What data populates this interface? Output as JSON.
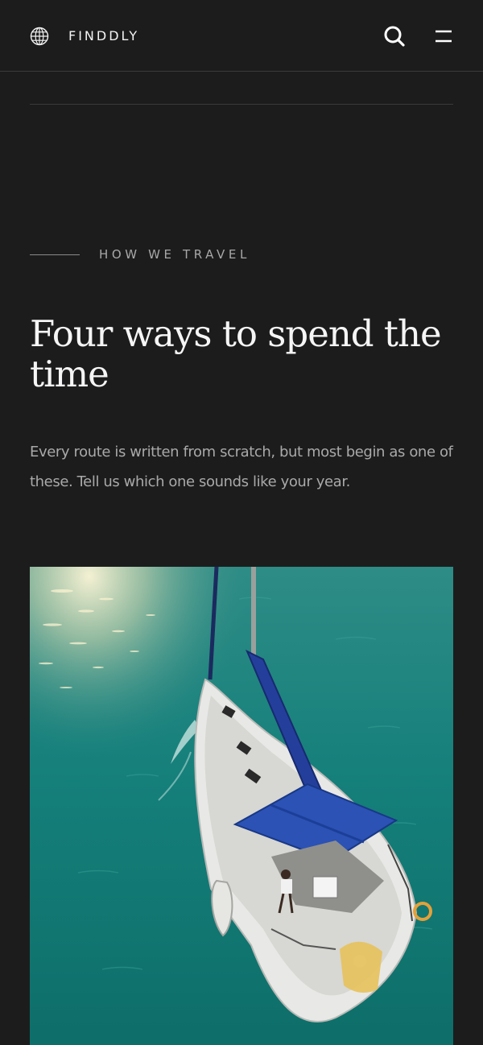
{
  "header": {
    "brand_icon": "globe-icon",
    "brand_name": "FINDDLY",
    "search_icon": "search-icon",
    "menu_icon": "menu-icon"
  },
  "section": {
    "eyebrow": "HOW WE TRAVEL",
    "heading": "Four ways to spend the time",
    "intro": "Every route is written from scratch, but most begin as one of these. Tell us which one sounds like your year."
  },
  "hero_image": {
    "subject": "sailboat-photo"
  },
  "colors": {
    "background": "#1c1c1d",
    "text_primary": "#f5f5f5",
    "text_muted": "#a9a9a9",
    "divider": "#3a3a3a",
    "sea": "#137d78",
    "sail": "#1f3f9a"
  }
}
